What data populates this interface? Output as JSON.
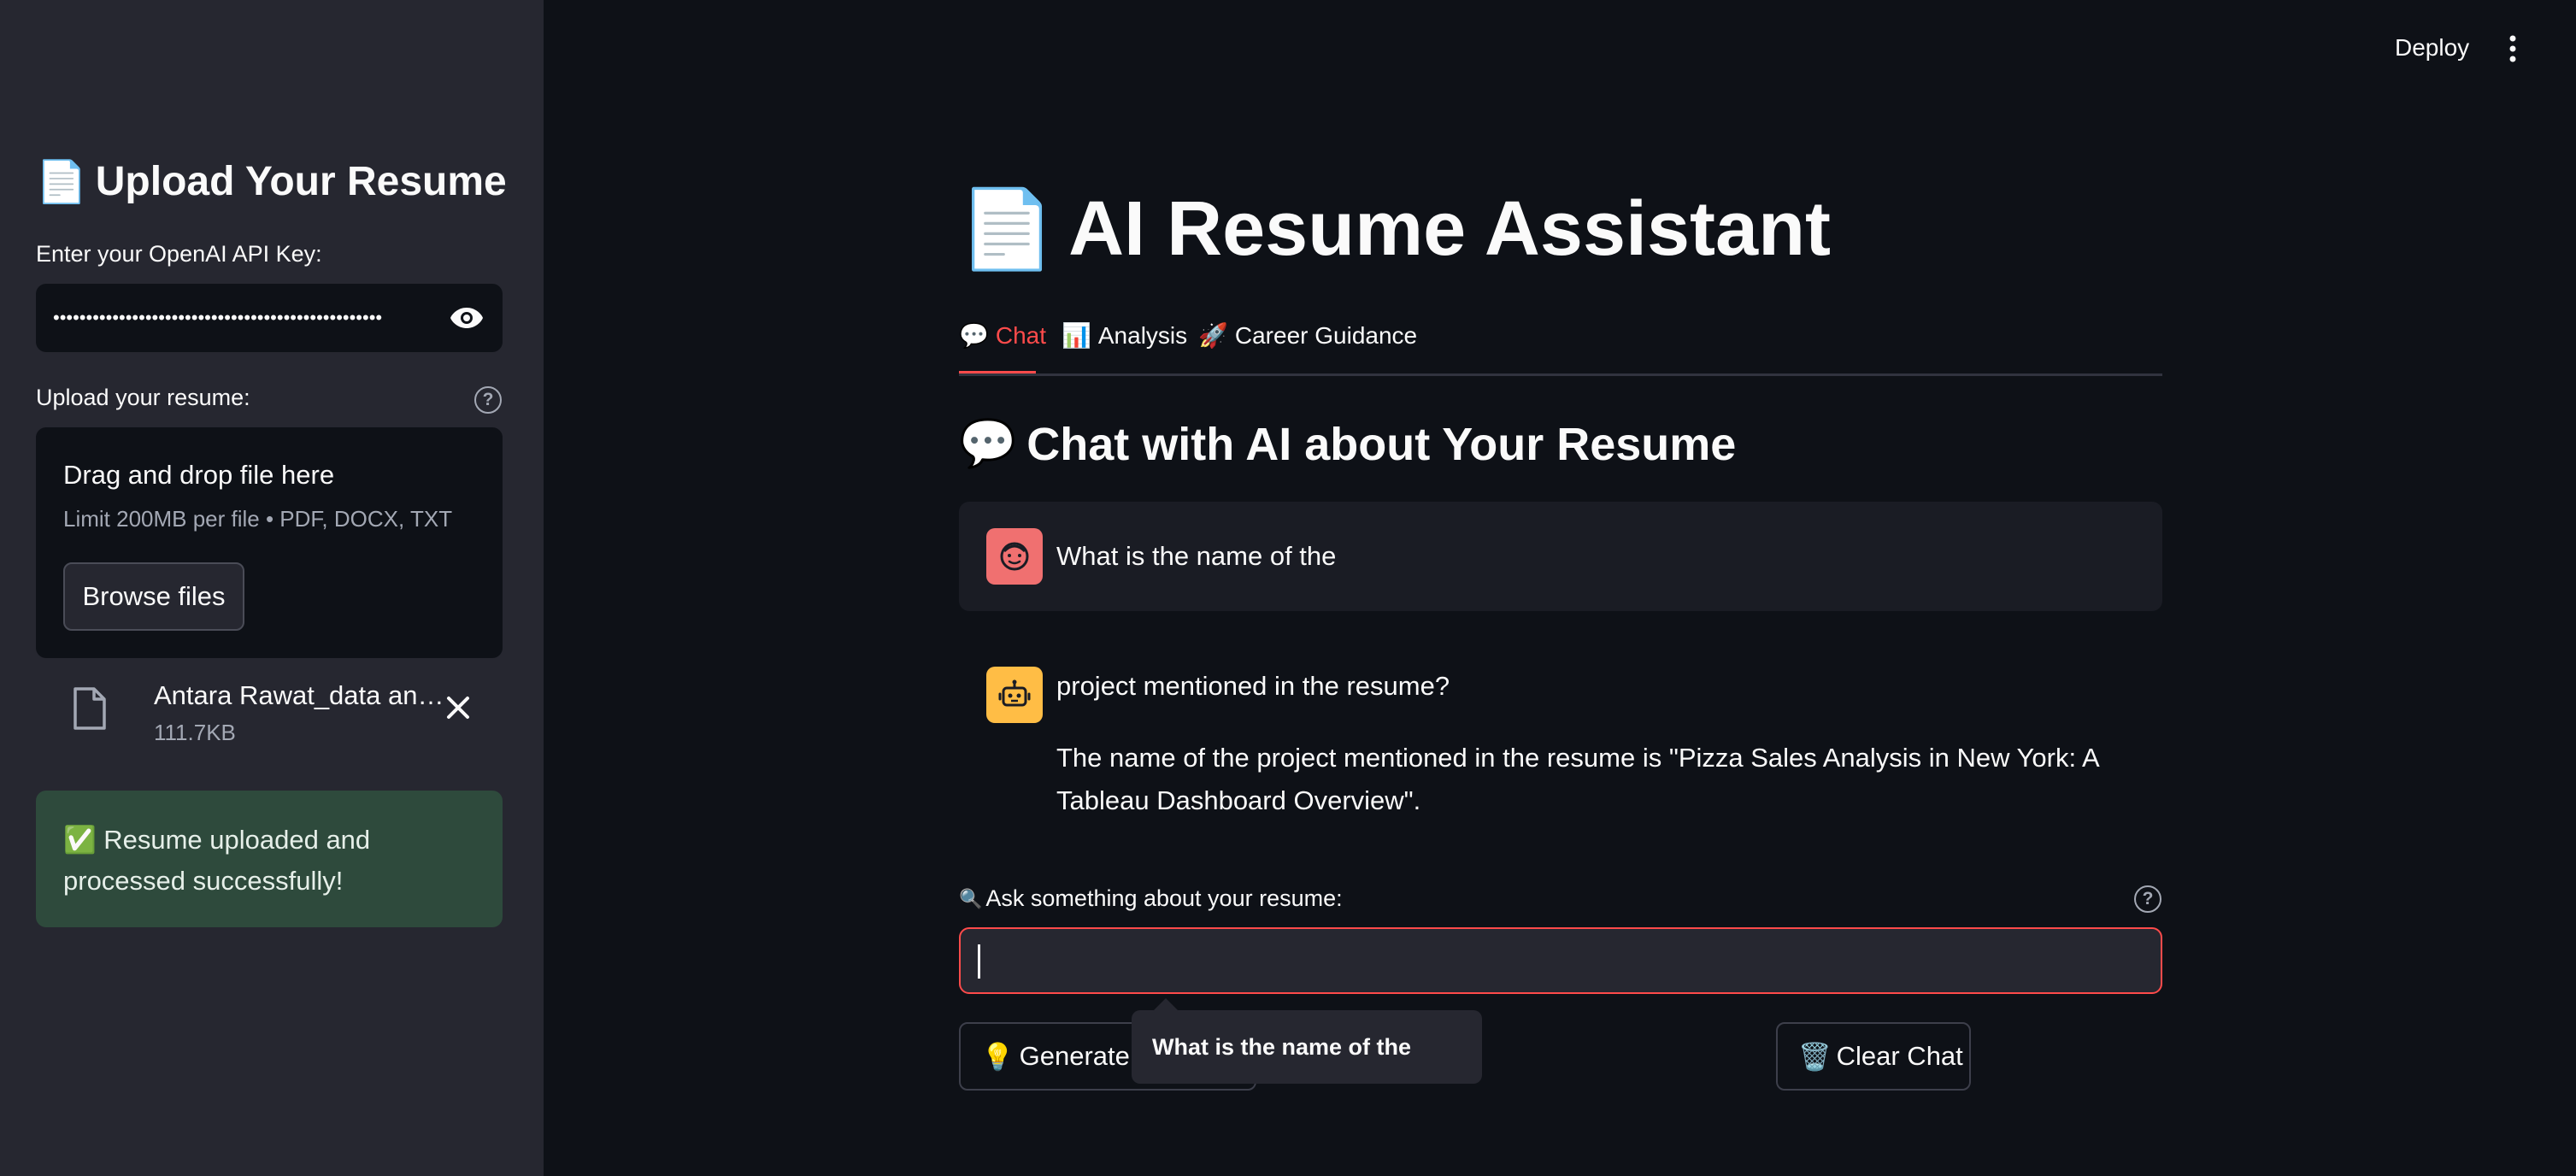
{
  "sidebar": {
    "title_icon": "📄",
    "title": "Upload Your Resume",
    "api_key_label": "Enter your OpenAI API Key:",
    "api_key_value": "••••••••••••••••••••••••••••••••••••••••••••••••••",
    "upload_label": "Upload your resume:",
    "dropzone_title": "Drag and drop file here",
    "dropzone_limits": "Limit 200MB per file • PDF, DOCX, TXT",
    "browse_label": "Browse files",
    "file": {
      "name": "Antara Rawat_data an…",
      "size": "111.7KB"
    },
    "success_message": "✅ Resume uploaded and processed successfully!"
  },
  "topbar": {
    "deploy_label": "Deploy"
  },
  "main": {
    "title_icon": "📄",
    "title": "AI Resume Assistant",
    "tabs": [
      {
        "icon": "💬",
        "label": "Chat",
        "active": true
      },
      {
        "icon": "📊",
        "label": "Analysis",
        "active": false
      },
      {
        "icon": "🚀",
        "label": "Career Guidance",
        "active": false
      }
    ],
    "section_icon": "💬",
    "section_title": "Chat with AI about Your Resume",
    "messages": [
      {
        "role": "user",
        "text": "What is the name of the"
      },
      {
        "role": "assistant",
        "text_line1": "project mentioned in the resume?",
        "text_line2": "The name of the project mentioned in the resume is \"Pizza Sales Analysis in New York: A Tableau Dashboard Overview\"."
      }
    ],
    "input_icon": "🔍",
    "input_label": "Ask something about your resume:",
    "input_value": "",
    "generate_button_icon": "💡",
    "generate_button_label": "Generate F",
    "clear_button_icon": "🗑️",
    "clear_button_label": "Clear Chat",
    "tooltip_text": "What is the name of the"
  },
  "colors": {
    "background": "#0e1117",
    "sidebar": "#262730",
    "accent": "#ff4b4b",
    "success_bg": "#2e4a3c",
    "user_avatar": "#f07070",
    "bot_avatar": "#ffbd45"
  }
}
